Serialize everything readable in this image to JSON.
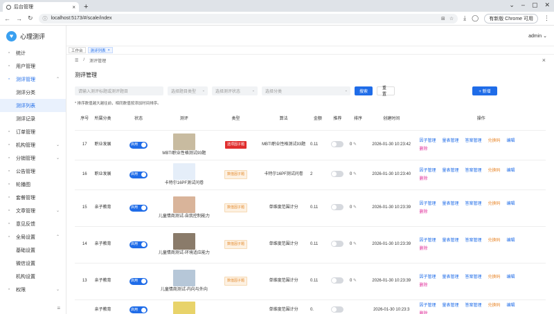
{
  "browser": {
    "tab_title": "后台管理",
    "url": "localhost:5173/#/scale/index",
    "update_label": "有新版 Chrome 可用"
  },
  "app": {
    "title": "心理测评",
    "user": "admin"
  },
  "sidebar": {
    "items": [
      {
        "label": "统计",
        "icon": "chart-icon"
      },
      {
        "label": "用户管理",
        "icon": "user-icon"
      },
      {
        "label": "测评管理",
        "icon": "heart-icon"
      },
      {
        "label": "测评分类"
      },
      {
        "label": "测评列表"
      },
      {
        "label": "测评记录"
      },
      {
        "label": "订单管理",
        "icon": "order-icon"
      },
      {
        "label": "机构管理",
        "icon": "org-icon"
      },
      {
        "label": "分销管理",
        "icon": "share-icon"
      },
      {
        "label": "公告管理",
        "icon": "bell-icon"
      },
      {
        "label": "轮播图",
        "icon": "image-icon"
      },
      {
        "label": "套餐管理",
        "icon": "package-icon"
      },
      {
        "label": "文章管理",
        "icon": "doc-icon"
      },
      {
        "label": "意见反馈",
        "icon": "feedback-icon"
      },
      {
        "label": "全局设置",
        "icon": "gear-icon"
      },
      {
        "label": "基础设置"
      },
      {
        "label": "微信设置"
      },
      {
        "label": "机构设置"
      },
      {
        "label": "权限",
        "icon": "lock-icon"
      }
    ]
  },
  "tags": {
    "home": "工作台",
    "current": "测评列表"
  },
  "breadcrumb": {
    "current": "测评管理"
  },
  "page": {
    "title": "测评管理",
    "search_placeholder": "请输入测评标题或测评题目",
    "type_placeholder": "选择题目类型",
    "status_placeholder": "选择测评状态",
    "category_placeholder": "选择分类",
    "search_btn": "搜索",
    "reset_btn": "重置",
    "add_btn": "+ 新增",
    "note": "* 排序数值越大越往前，相同数值按添加时间排序。"
  },
  "table": {
    "headers": [
      "序号",
      "所属分类",
      "状态",
      "测评",
      "类型",
      "算法",
      "金额",
      "推荐",
      "排序",
      "创建时间",
      "操作"
    ],
    "status_on": "启用",
    "ops": [
      "因子管理",
      "量表管理",
      "答案管理",
      "兑换码",
      "编辑",
      "删除"
    ],
    "rows": [
      {
        "id": "17",
        "cat": "职业发展",
        "name": "MBTI职业性格测试93题",
        "type": "选项因子题",
        "type_color": "red",
        "algo": "MBTI职业性格测试93题",
        "price": "0.11",
        "sort": "0",
        "time": "2026-01-30 10:23:42",
        "thumb": "#c8bba0"
      },
      {
        "id": "16",
        "cat": "职业发展",
        "name": "卡特尔16PF测试问卷",
        "type": "数值因子题",
        "type_color": "orange",
        "algo": "卡特尔16PF测试问卷",
        "price": "2",
        "sort": "0",
        "time": "2026-01-30 10:23:40",
        "thumb": "#e5eef9"
      },
      {
        "id": "15",
        "cat": "亲子教育",
        "name": "儿童情商测试-自我控制能力",
        "type": "数值因子题",
        "type_color": "orange",
        "algo": "单维度范围计分",
        "price": "0.11",
        "sort": "0",
        "time": "2026-01-30 10:23:39",
        "thumb": "#d9b49a"
      },
      {
        "id": "14",
        "cat": "亲子教育",
        "name": "儿童情商测试-环境适应能力",
        "type": "数值因子题",
        "type_color": "orange",
        "algo": "单维度范围计分",
        "price": "0.11",
        "sort": "0",
        "time": "2026-01-30 10:23:39",
        "thumb": "#8a7b6a"
      },
      {
        "id": "13",
        "cat": "亲子教育",
        "name": "儿童情商测试-内向与外向",
        "type": "数值因子题",
        "type_color": "orange",
        "algo": "单维度范围计分",
        "price": "0.11",
        "sort": "0",
        "time": "2026-01-30 10:23:39",
        "thumb": "#b6c7d8"
      },
      {
        "id": "",
        "cat": "亲子教育",
        "name": "",
        "type": "",
        "type_color": "orange",
        "algo": "单维度范围计分",
        "price": "0.",
        "sort": "",
        "time": "2026-01-30 10:23:3",
        "thumb": "#e8d36a"
      }
    ]
  }
}
